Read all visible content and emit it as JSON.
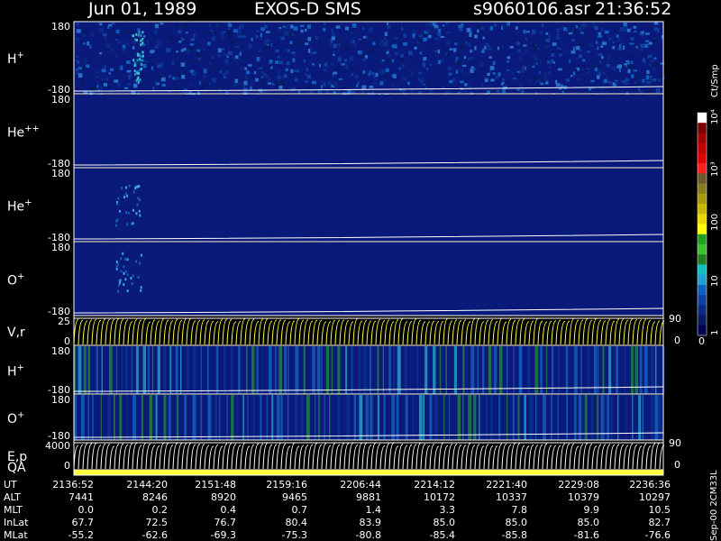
{
  "header": {
    "date": "Jun 01, 1989",
    "instrument": "EXOS-D SMS",
    "file": "s9060106.asr",
    "time": "21:36:52"
  },
  "chart_data": {
    "type": "heatmap",
    "panels": [
      {
        "label": "H",
        "sup": "+",
        "ticks": [
          "180",
          "-180"
        ],
        "intensity": "high"
      },
      {
        "label": "He",
        "sup": "++",
        "ticks": [
          "180",
          "-180"
        ],
        "intensity": "low"
      },
      {
        "label": "He",
        "sup": "+",
        "ticks": [
          "180",
          "-180"
        ],
        "intensity": "patch"
      },
      {
        "label": "O",
        "sup": "+",
        "ticks": [
          "180",
          "-180"
        ],
        "intensity": "patch"
      },
      {
        "label": "V,r",
        "sup": "",
        "ticks": [
          "25",
          "0"
        ],
        "right_ticks": [
          "90",
          "0"
        ],
        "intensity": "lines"
      },
      {
        "label": "H",
        "sup": "+",
        "ticks": [
          "180",
          "-180"
        ],
        "intensity": "stripes"
      },
      {
        "label": "O",
        "sup": "+",
        "ticks": [
          "180",
          "-180"
        ],
        "intensity": "stripes"
      },
      {
        "label": "E,p",
        "sup": "",
        "ticks": [
          "4000",
          "0"
        ],
        "right_ticks": [
          "90",
          "0"
        ],
        "intensity": "lines"
      },
      {
        "label": "QA",
        "sup": "",
        "ticks": [],
        "intensity": "bar"
      }
    ],
    "colorbar": {
      "unit": "Ct/Smp",
      "ticks": [
        "10⁴",
        "10³",
        "100",
        "10",
        "1",
        "0"
      ],
      "colors": [
        "#ffffff",
        "#7a0000",
        "#a00000",
        "#c00000",
        "#e00000",
        "#ff2020",
        "#6a5a2a",
        "#8a7a20",
        "#a89a10",
        "#c8b800",
        "#e8d800",
        "#ffff00",
        "#20a020",
        "#40c030",
        "#208020",
        "#10c0c0",
        "#20a0d0",
        "#1060c0",
        "#1040a0",
        "#0a2a80",
        "#061a60",
        "#000050"
      ]
    },
    "side_note": "Sep-00 2CM33L",
    "orbit_table": {
      "rows": [
        "UT",
        "ALT",
        "MLT",
        "InLat",
        "MLat"
      ],
      "values": [
        [
          "2136:52",
          "2144:20",
          "2151:48",
          "2159:16",
          "2206:44",
          "2214:12",
          "2221:40",
          "2229:08",
          "2236:36"
        ],
        [
          "7441",
          "8246",
          "8920",
          "9465",
          "9881",
          "10172",
          "10337",
          "10379",
          "10297"
        ],
        [
          "0.0",
          "0.2",
          "0.4",
          "0.7",
          "1.4",
          "3.3",
          "7.8",
          "9.9",
          "10.5"
        ],
        [
          "67.7",
          "72.5",
          "76.7",
          "80.4",
          "83.9",
          "85.0",
          "85.0",
          "85.0",
          "82.7"
        ],
        [
          "-55.2",
          "-62.6",
          "-69.3",
          "-75.3",
          "-80.8",
          "-85.4",
          "-85.8",
          "-81.6",
          "-76.6"
        ]
      ]
    }
  }
}
